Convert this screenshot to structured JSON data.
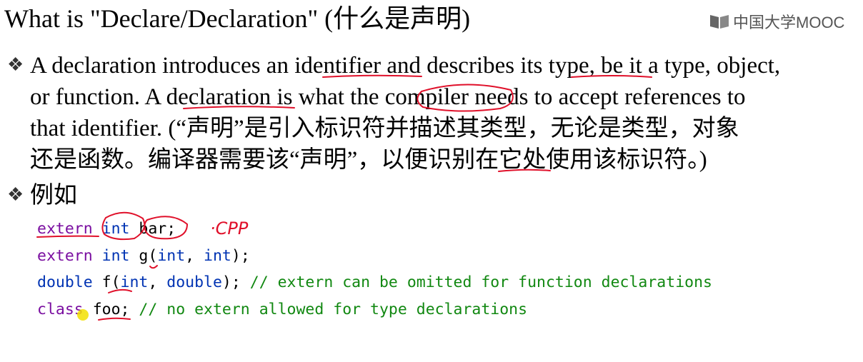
{
  "slide": {
    "title": "What is \"Declare/Declaration\" (什么是声明)",
    "logo_text": "中国大学MOOC",
    "bullet_glyph": "❖",
    "paragraph": {
      "line1_a": "A declaration introduces an ",
      "line1_b": "identifier",
      "line1_c": " and describes ",
      "line1_d": "its type,",
      "line1_e": " be it a type, object,",
      "line2_a": "or function. A ",
      "line2_b": "declaration",
      "line2_c": " is what the ",
      "line2_d": "compiler",
      "line2_e": " needs to accept references to",
      "line3": "that identifier. (“声明”是引入标识符并描述其类型，无论是类型，对象",
      "line4": "还是函数。编译器需要该“声明”，以便识别在它处使用该标识符。)"
    },
    "example_label": "例如",
    "code": {
      "l1_kw": "extern",
      "l1_type": "int",
      "l1_rest": "bar;",
      "l2_kw": "extern",
      "l2_type": "int",
      "l2_name": "g(",
      "l2_p1": "int",
      "l2_sep": ", ",
      "l2_p2": "int",
      "l2_end": ");",
      "l3_type": "double",
      "l3_name": "f(",
      "l3_p1": "int",
      "l3_sep": ", ",
      "l3_p2": "double",
      "l3_end": ");",
      "l3_comment": "// extern can be omitted for function declarations",
      "l4_kw": "class",
      "l4_name": "foo;",
      "l4_comment": "// no extern allowed for type declarations"
    },
    "annotation_text": "·CPP"
  },
  "colors": {
    "keyword": "#7a0ea0",
    "type": "#0033b3",
    "comment": "#118811",
    "ink": "#e0102a",
    "cursor": "#f2e000"
  }
}
